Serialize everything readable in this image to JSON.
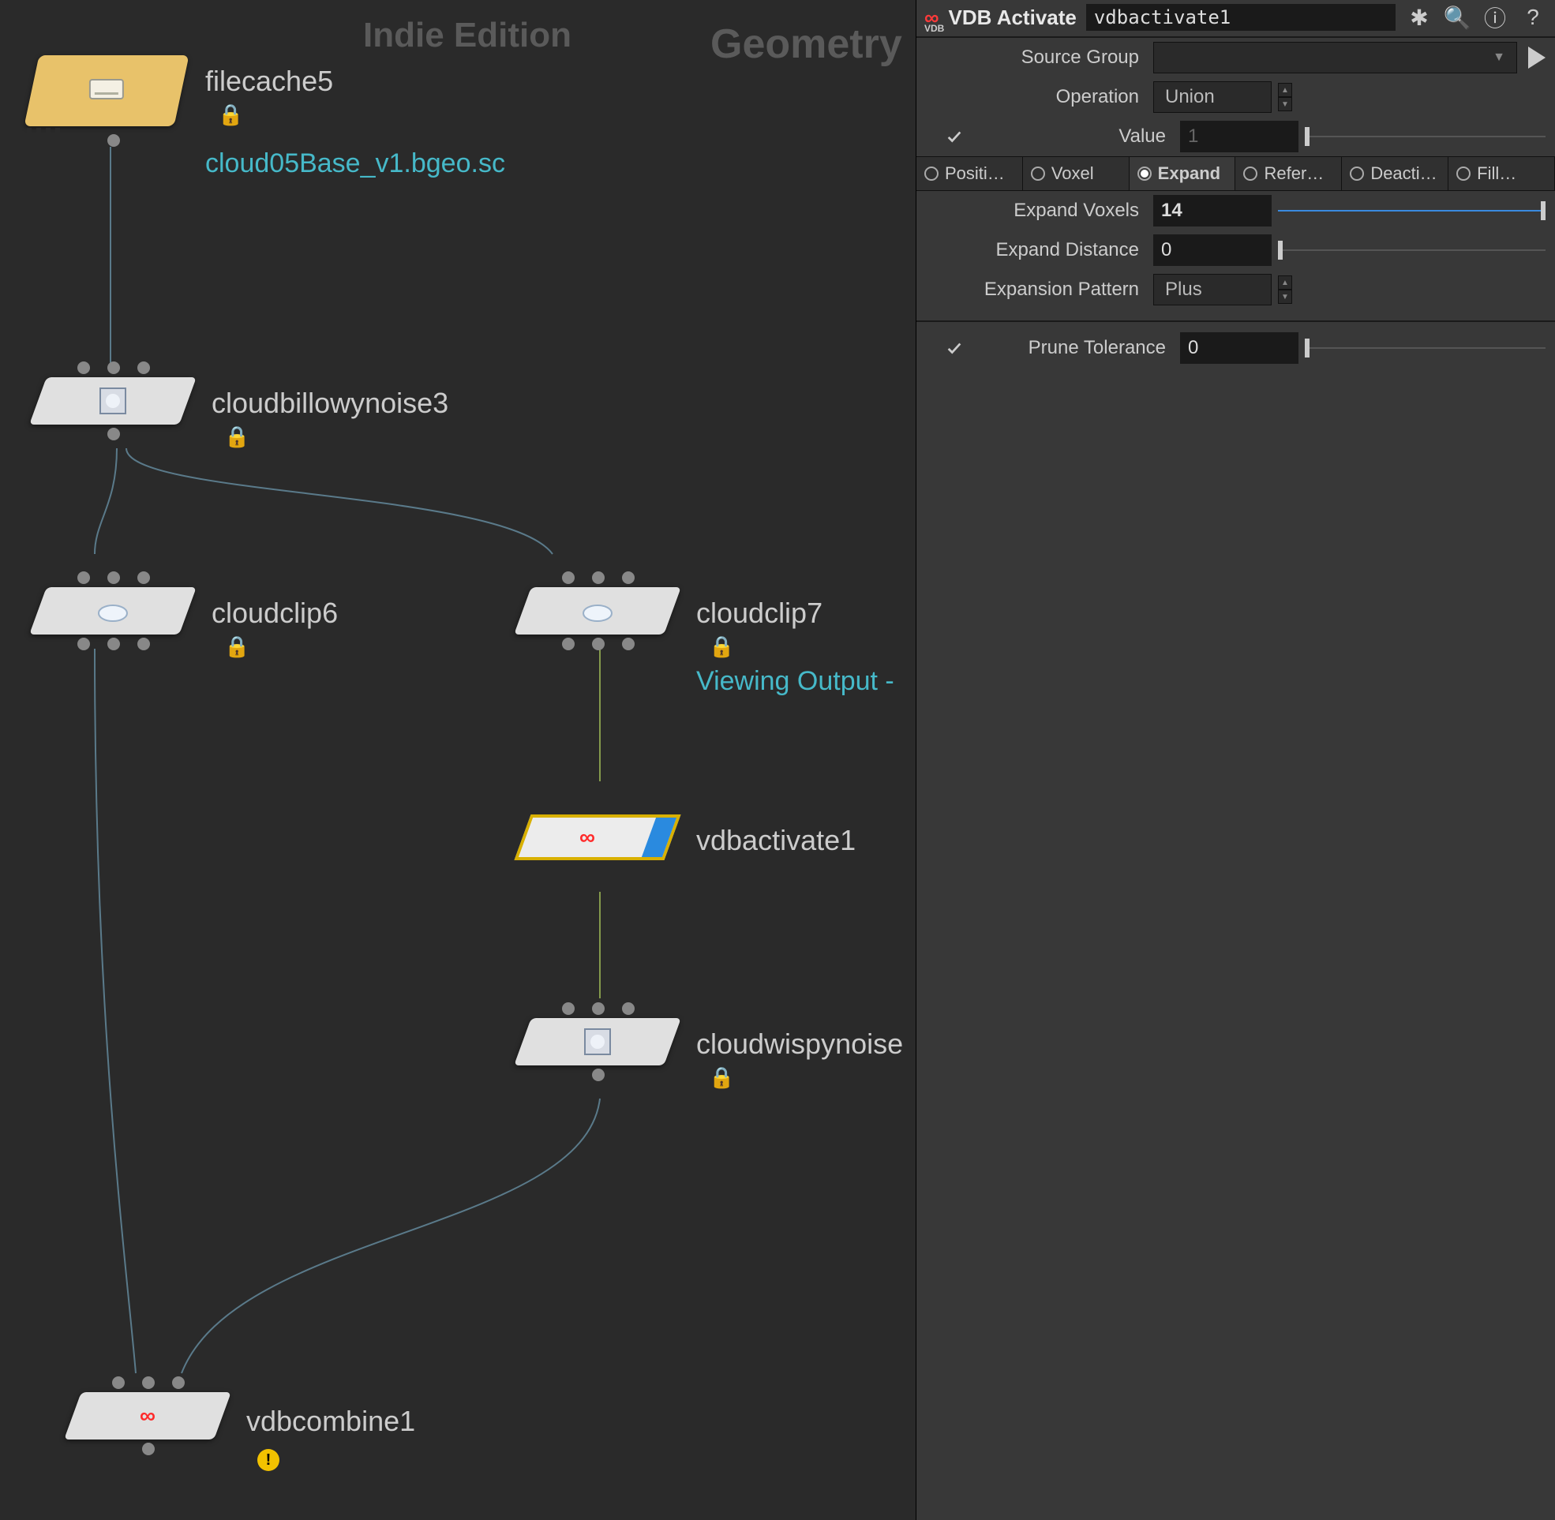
{
  "watermark": {
    "indie": "Indie Edition",
    "geom": "Geometry"
  },
  "nodes": {
    "filecache": {
      "label": "filecache5",
      "asset": "cloud05Base_v1.bgeo.sc"
    },
    "billowy": {
      "label": "cloudbillowynoise3"
    },
    "clip6": {
      "label": "cloudclip6"
    },
    "clip7": {
      "label": "cloudclip7",
      "status": "Viewing Output -"
    },
    "vdbactivate": {
      "label": "vdbactivate1"
    },
    "wispy": {
      "label": "cloudwispynoise"
    },
    "vdbcombine": {
      "label": "vdbcombine1"
    }
  },
  "params": {
    "type": "VDB Activate",
    "name": "vdbactivate1",
    "source_group_label": "Source Group",
    "source_group_value": "",
    "operation_label": "Operation",
    "operation_value": "Union",
    "value_label": "Value",
    "value_value": "1",
    "tabs": [
      "Positi…",
      "Voxel",
      "Expand",
      "Refer…",
      "Deacti…",
      "Fill…"
    ],
    "active_tab": 2,
    "expand_voxels_label": "Expand Voxels",
    "expand_voxels_value": "14",
    "expand_distance_label": "Expand Distance",
    "expand_distance_value": "0",
    "expansion_pattern_label": "Expansion Pattern",
    "expansion_pattern_value": "Plus",
    "prune_tolerance_label": "Prune Tolerance",
    "prune_tolerance_value": "0"
  }
}
